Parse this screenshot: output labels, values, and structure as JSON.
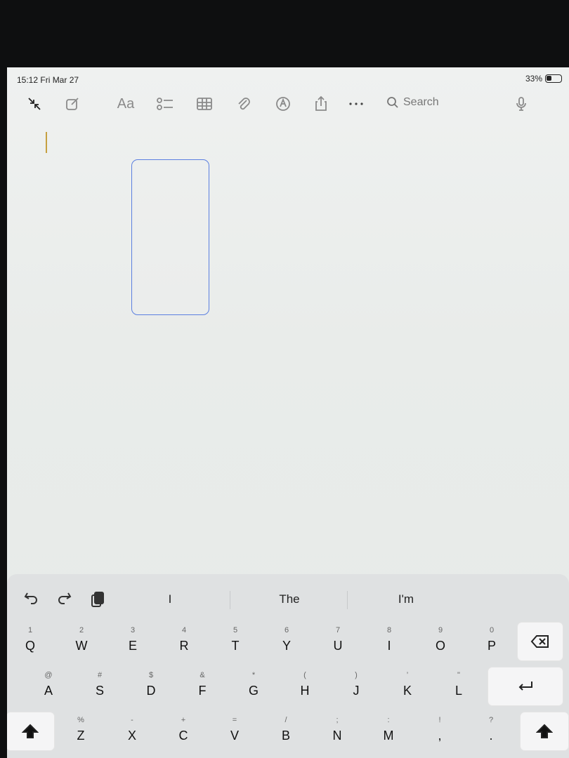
{
  "status_bar": {
    "time": "15:12  Fri Mar 27",
    "battery_percent": "33%",
    "battery_level": 0.33
  },
  "toolbar": {
    "collapse_icon": "collapse-arrows-icon",
    "compose_icon": "compose-icon",
    "format_label": "Aa",
    "checklist_icon": "checklist-icon",
    "table_icon": "table-icon",
    "attachment_icon": "paperclip-icon",
    "markup_icon": "markup-pen-icon",
    "share_icon": "share-icon",
    "more_icon": "ellipsis-icon",
    "search_placeholder": "Search",
    "dictation_icon": "microphone-icon"
  },
  "keyboard": {
    "suggestions": [
      "I",
      "The",
      "I'm"
    ],
    "row1": [
      {
        "main": "Q",
        "sub": "1"
      },
      {
        "main": "W",
        "sub": "2"
      },
      {
        "main": "E",
        "sub": "3"
      },
      {
        "main": "R",
        "sub": "4"
      },
      {
        "main": "T",
        "sub": "5"
      },
      {
        "main": "Y",
        "sub": "6"
      },
      {
        "main": "U",
        "sub": "7"
      },
      {
        "main": "I",
        "sub": "8"
      },
      {
        "main": "O",
        "sub": "9"
      },
      {
        "main": "P",
        "sub": "0"
      }
    ],
    "row2": [
      {
        "main": "A",
        "sub": "@"
      },
      {
        "main": "S",
        "sub": "#"
      },
      {
        "main": "D",
        "sub": "$"
      },
      {
        "main": "F",
        "sub": "&"
      },
      {
        "main": "G",
        "sub": "*"
      },
      {
        "main": "H",
        "sub": "("
      },
      {
        "main": "J",
        "sub": ")"
      },
      {
        "main": "K",
        "sub": "’"
      },
      {
        "main": "L",
        "sub": "\""
      }
    ],
    "row3": [
      {
        "main": "Z",
        "sub": "%"
      },
      {
        "main": "X",
        "sub": "-"
      },
      {
        "main": "C",
        "sub": "+"
      },
      {
        "main": "V",
        "sub": "="
      },
      {
        "main": "B",
        "sub": "/"
      },
      {
        "main": "N",
        "sub": ";"
      },
      {
        "main": "M",
        "sub": ":"
      },
      {
        "main": ",",
        "sub": "!"
      },
      {
        "main": ".",
        "sub": "?"
      }
    ]
  }
}
